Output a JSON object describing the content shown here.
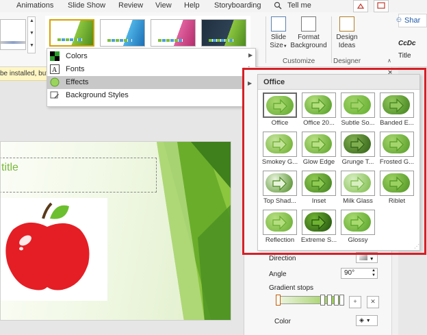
{
  "ribbon_tabs": [
    "Animations",
    "Slide Show",
    "Review",
    "View",
    "Help",
    "Storyboarding",
    "Tell me"
  ],
  "ribbon_groups": {
    "customize": {
      "label": "Customize",
      "slide_size": "Slide\nSize",
      "format_background": "Format\nBackground"
    },
    "designer": {
      "label": "Designer",
      "design_ideas": "Design\nIdeas"
    }
  },
  "right_edge": {
    "share": "Shar",
    "ccdc": "CcDc",
    "title": "Title"
  },
  "message_bar": "be installed, but",
  "variants_menu": {
    "items": [
      {
        "label": "Colors",
        "icon": "colors-icon",
        "has_submenu": true
      },
      {
        "label": "Fonts",
        "icon": "fonts-icon",
        "has_submenu": true
      },
      {
        "label": "Effects",
        "icon": "effects-icon",
        "has_submenu": true,
        "highlighted": true
      },
      {
        "label": "Background Styles",
        "icon": "background-styles-icon",
        "has_submenu": true
      }
    ]
  },
  "slide": {
    "title_text": "title"
  },
  "effects_gallery": {
    "header": "Office",
    "items": [
      "Office",
      "Office 20...",
      "Subtle So...",
      "Banded E...",
      "Smokey G...",
      "Glow Edge",
      "Grunge T...",
      "Frosted G...",
      "Top Shad...",
      "Inset",
      "Milk Glass",
      "Riblet",
      "Reflection",
      "Extreme S...",
      "Glossy"
    ],
    "selected_index": 0
  },
  "format_pane": {
    "direction_label": "Direction",
    "angle_label": "Angle",
    "angle_value": "90°",
    "gradient_stops_label": "Gradient stops",
    "color_label": "Color"
  },
  "colors": {
    "accent_green": "#8cc63f",
    "highlight_red": "#d61f26"
  }
}
